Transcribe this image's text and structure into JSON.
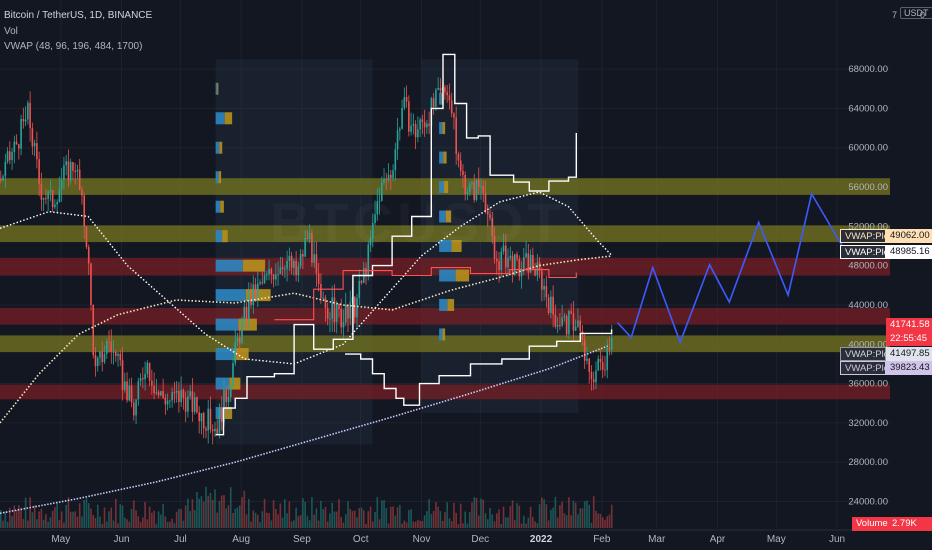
{
  "header": {
    "symbol_line": "Bitcoin / TetherUS, 1D, BINANCE",
    "vol_label": "Vol",
    "vwap_label": "VWAP (48, 96, 196, 484, 1700)"
  },
  "corner": {
    "currency": "USDT",
    "top_zero": "0",
    "top_seven": "7"
  },
  "watermark": "BTCUSDT",
  "tags": {
    "vwap1": {
      "label": "VWAP:Plot",
      "value": "49062.00"
    },
    "vwap2": {
      "label": "VWAP:Plot",
      "value": "48985.16"
    },
    "price": {
      "value": "41741.58",
      "countdown": "22:55:45"
    },
    "vwap3": {
      "label": "VWAP:Plot",
      "value": "41497.85"
    },
    "vwap4": {
      "label": "VWAP:Plot",
      "value": "39823.43"
    },
    "volume": {
      "label": "Volume",
      "value": "2.79K"
    }
  },
  "colors": {
    "background": "#131722",
    "up": "#26a69a",
    "down": "#ef5350",
    "yellow_zone": "#7a7a1e",
    "red_zone": "#7a1e24",
    "projection": "#3d5afe",
    "vwap_white": "#ffffff",
    "vwap_lavender": "#c8c8ff",
    "price_tag": "#f23645",
    "vwap_tag_orange": "#ffe0b2",
    "vwap_tag_purple": "#d1c4e9"
  },
  "chart_data": {
    "type": "line",
    "title": "Bitcoin / TetherUS, 1D, BINANCE",
    "y_axis_ticks": [
      68000,
      64000,
      60000,
      56000,
      52000,
      48000,
      44000,
      40000,
      36000,
      32000,
      28000,
      24000
    ],
    "y_tick_labels": [
      "68000.00",
      "64000.00",
      "60000.00",
      "56000.00",
      "52000.00",
      "48000.00",
      "44000.00",
      "40000.00",
      "36000.00",
      "32000.00",
      "28000.00",
      "24000.00"
    ],
    "ylim": [
      21300,
      73000
    ],
    "x_tick_labels": [
      "May",
      "Jun",
      "Jul",
      "Aug",
      "Sep",
      "Oct",
      "Nov",
      "Dec",
      "2022",
      "Feb",
      "Mar",
      "Apr",
      "May",
      "Jun"
    ],
    "x_tick_days": [
      31,
      62,
      92,
      123,
      154,
      184,
      215,
      245,
      276,
      307,
      335,
      366,
      396,
      427
    ],
    "xlim": [
      0,
      454
    ],
    "zones": [
      {
        "type": "resistance",
        "from": 55200,
        "to": 56900
      },
      {
        "type": "resistance",
        "from": 50400,
        "to": 52100
      },
      {
        "type": "support",
        "from": 47000,
        "to": 48800
      },
      {
        "type": "support",
        "from": 42000,
        "to": 43700
      },
      {
        "type": "resistance",
        "from": 39200,
        "to": 40900
      },
      {
        "type": "support",
        "from": 34400,
        "to": 35900
      }
    ],
    "price_series": [
      {
        "d": 0,
        "v": 56800
      },
      {
        "d": 8,
        "v": 60500
      },
      {
        "d": 14,
        "v": 63500
      },
      {
        "d": 20,
        "v": 56000
      },
      {
        "d": 26,
        "v": 54500
      },
      {
        "d": 32,
        "v": 57200
      },
      {
        "d": 38,
        "v": 58500
      },
      {
        "d": 44,
        "v": 50500
      },
      {
        "d": 48,
        "v": 37000
      },
      {
        "d": 55,
        "v": 40500
      },
      {
        "d": 62,
        "v": 36500
      },
      {
        "d": 68,
        "v": 33200
      },
      {
        "d": 74,
        "v": 38500
      },
      {
        "d": 80,
        "v": 35000
      },
      {
        "d": 86,
        "v": 34300
      },
      {
        "d": 92,
        "v": 34800
      },
      {
        "d": 98,
        "v": 33800
      },
      {
        "d": 104,
        "v": 32400
      },
      {
        "d": 110,
        "v": 31600
      },
      {
        "d": 116,
        "v": 35500
      },
      {
        "d": 121,
        "v": 40500
      },
      {
        "d": 127,
        "v": 44500
      },
      {
        "d": 133,
        "v": 46000
      },
      {
        "d": 139,
        "v": 47500
      },
      {
        "d": 145,
        "v": 48800
      },
      {
        "d": 151,
        "v": 47000
      },
      {
        "d": 157,
        "v": 51500
      },
      {
        "d": 163,
        "v": 44000
      },
      {
        "d": 169,
        "v": 43500
      },
      {
        "d": 175,
        "v": 42500
      },
      {
        "d": 181,
        "v": 44000
      },
      {
        "d": 187,
        "v": 48500
      },
      {
        "d": 193,
        "v": 55500
      },
      {
        "d": 199,
        "v": 57500
      },
      {
        "d": 205,
        "v": 64500
      },
      {
        "d": 211,
        "v": 61500
      },
      {
        "d": 217,
        "v": 63000
      },
      {
        "d": 223,
        "v": 65000
      },
      {
        "d": 228,
        "v": 66500
      },
      {
        "d": 234,
        "v": 57500
      },
      {
        "d": 240,
        "v": 55500
      },
      {
        "d": 246,
        "v": 56500
      },
      {
        "d": 252,
        "v": 48500
      },
      {
        "d": 258,
        "v": 49000
      },
      {
        "d": 264,
        "v": 47500
      },
      {
        "d": 270,
        "v": 48500
      },
      {
        "d": 276,
        "v": 46500
      },
      {
        "d": 282,
        "v": 43000
      },
      {
        "d": 288,
        "v": 42000
      },
      {
        "d": 294,
        "v": 42500
      },
      {
        "d": 300,
        "v": 36500
      },
      {
        "d": 304,
        "v": 37500
      },
      {
        "d": 308,
        "v": 38500
      },
      {
        "d": 312,
        "v": 41741
      }
    ],
    "projection_series": [
      {
        "d": 315,
        "v": 42200
      },
      {
        "d": 322,
        "v": 40700
      },
      {
        "d": 333,
        "v": 47800
      },
      {
        "d": 347,
        "v": 40200
      },
      {
        "d": 362,
        "v": 48100
      },
      {
        "d": 372,
        "v": 44300
      },
      {
        "d": 387,
        "v": 52400
      },
      {
        "d": 402,
        "v": 45000
      },
      {
        "d": 414,
        "v": 55300
      },
      {
        "d": 432,
        "v": 49200
      }
    ],
    "vwap_lavender": [
      {
        "d": 0,
        "v": 22800
      },
      {
        "d": 40,
        "v": 24300
      },
      {
        "d": 80,
        "v": 26000
      },
      {
        "d": 120,
        "v": 28000
      },
      {
        "d": 160,
        "v": 30300
      },
      {
        "d": 200,
        "v": 32600
      },
      {
        "d": 240,
        "v": 35000
      },
      {
        "d": 280,
        "v": 37500
      },
      {
        "d": 310,
        "v": 39823
      }
    ],
    "vwap_dotted_cream": [
      {
        "d": 0,
        "v": 32000
      },
      {
        "d": 20,
        "v": 37000
      },
      {
        "d": 40,
        "v": 41000
      },
      {
        "d": 60,
        "v": 43000
      },
      {
        "d": 90,
        "v": 44500
      },
      {
        "d": 120,
        "v": 44200
      },
      {
        "d": 150,
        "v": 45200
      },
      {
        "d": 175,
        "v": 44000
      },
      {
        "d": 200,
        "v": 43500
      },
      {
        "d": 230,
        "v": 45500
      },
      {
        "d": 255,
        "v": 46800
      },
      {
        "d": 275,
        "v": 48000
      },
      {
        "d": 295,
        "v": 48600
      },
      {
        "d": 312,
        "v": 48985
      }
    ],
    "vwap_dotted_white": [
      {
        "d": 0,
        "v": 51800
      },
      {
        "d": 25,
        "v": 53500
      },
      {
        "d": 45,
        "v": 53000
      },
      {
        "d": 65,
        "v": 48000
      },
      {
        "d": 85,
        "v": 44500
      },
      {
        "d": 105,
        "v": 41000
      },
      {
        "d": 125,
        "v": 38500
      },
      {
        "d": 150,
        "v": 38000
      },
      {
        "d": 175,
        "v": 40000
      },
      {
        "d": 195,
        "v": 44500
      },
      {
        "d": 215,
        "v": 49000
      },
      {
        "d": 235,
        "v": 52000
      },
      {
        "d": 255,
        "v": 54500
      },
      {
        "d": 275,
        "v": 55500
      },
      {
        "d": 290,
        "v": 54000
      },
      {
        "d": 305,
        "v": 50500
      },
      {
        "d": 312,
        "v": 49062
      }
    ],
    "vwap_white_step": [
      {
        "d": 110,
        "v": 30800
      },
      {
        "d": 114,
        "v": 33500
      },
      {
        "d": 120,
        "v": 34500
      },
      {
        "d": 126,
        "v": 36700
      },
      {
        "d": 140,
        "v": 37000
      },
      {
        "d": 150,
        "v": 42000
      },
      {
        "d": 160,
        "v": 39500
      },
      {
        "d": 170,
        "v": 40500
      },
      {
        "d": 180,
        "v": 47000
      },
      {
        "d": 190,
        "v": 48000
      },
      {
        "d": 200,
        "v": 51000
      },
      {
        "d": 210,
        "v": 53000
      },
      {
        "d": 220,
        "v": 64000
      },
      {
        "d": 226,
        "v": 69500
      },
      {
        "d": 232,
        "v": 64500
      },
      {
        "d": 238,
        "v": 61000
      },
      {
        "d": 244,
        "v": 61200
      },
      {
        "d": 250,
        "v": 57200
      },
      {
        "d": 262,
        "v": 56500
      },
      {
        "d": 270,
        "v": 55600
      },
      {
        "d": 280,
        "v": 56600
      },
      {
        "d": 290,
        "v": 57000
      },
      {
        "d": 294,
        "v": 61500
      }
    ],
    "vwap_white_lower": [
      {
        "d": 176,
        "v": 39000
      },
      {
        "d": 184,
        "v": 38500
      },
      {
        "d": 190,
        "v": 37000
      },
      {
        "d": 196,
        "v": 35500
      },
      {
        "d": 202,
        "v": 34500
      },
      {
        "d": 206,
        "v": 33800
      },
      {
        "d": 214,
        "v": 36000
      },
      {
        "d": 224,
        "v": 36800
      },
      {
        "d": 240,
        "v": 38000
      },
      {
        "d": 256,
        "v": 38500
      },
      {
        "d": 270,
        "v": 39800
      },
      {
        "d": 284,
        "v": 40300
      },
      {
        "d": 296,
        "v": 41100
      },
      {
        "d": 312,
        "v": 41497
      }
    ],
    "volume_profile_left": [
      {
        "price": 66000,
        "vol": 0.05
      },
      {
        "price": 63000,
        "vol": 0.3
      },
      {
        "price": 60000,
        "vol": 0.12
      },
      {
        "price": 57000,
        "vol": 0.1
      },
      {
        "price": 54000,
        "vol": 0.15
      },
      {
        "price": 51000,
        "vol": 0.22
      },
      {
        "price": 48000,
        "vol": 0.9
      },
      {
        "price": 45000,
        "vol": 1.0
      },
      {
        "price": 42000,
        "vol": 0.75
      },
      {
        "price": 39000,
        "vol": 0.6
      },
      {
        "price": 36000,
        "vol": 0.45
      },
      {
        "price": 33000,
        "vol": 0.3
      }
    ],
    "volume_profile_right": [
      {
        "price": 65000,
        "vol": 0.15
      },
      {
        "price": 62000,
        "vol": 0.2
      },
      {
        "price": 59000,
        "vol": 0.25
      },
      {
        "price": 56000,
        "vol": 0.3
      },
      {
        "price": 53000,
        "vol": 0.4
      },
      {
        "price": 50000,
        "vol": 0.75
      },
      {
        "price": 47000,
        "vol": 1.0
      },
      {
        "price": 44000,
        "vol": 0.5
      },
      {
        "price": 41000,
        "vol": 0.2
      }
    ]
  }
}
